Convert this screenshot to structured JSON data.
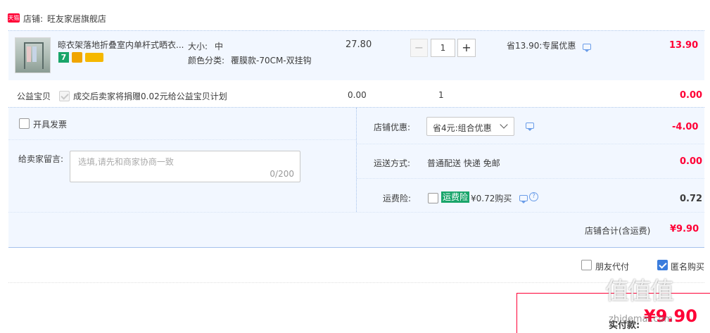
{
  "shop": {
    "badge": "天猫",
    "label": "店铺:",
    "name": "旺友家居旗舰店"
  },
  "item": {
    "title": "晾衣架落地折叠室内单杆式晒衣...",
    "size_label": "大小:",
    "size_value": "中",
    "color_label": "颜色分类:",
    "color_value": "覆膜款-70CM-双挂钩",
    "price": "27.80",
    "quantity": "1",
    "discount": "省13.90:专属优惠",
    "total": "13.90"
  },
  "charity": {
    "label": "公益宝贝",
    "text": "成交后卖家将捐赠0.02元给公益宝贝计划",
    "price": "0.00",
    "quantity": "1",
    "total": "0.00"
  },
  "invoice": {
    "label": "开具发票"
  },
  "message": {
    "label": "给卖家留言:",
    "placeholder": "选填,请先和商家协商一致",
    "counter": "0/200"
  },
  "shop_discount": {
    "label": "店铺优惠:",
    "selected": "省4元:组合优惠",
    "amount": "-4.00"
  },
  "shipping": {
    "label": "运送方式:",
    "value": "普通配送 快递 免邮",
    "amount": "0.00"
  },
  "insurance": {
    "label": "运费险:",
    "badge": "运费险",
    "value": "¥0.72购买",
    "amount": "0.72"
  },
  "shop_total": {
    "label": "店铺合计(含运费)",
    "amount": "¥9.90"
  },
  "options": {
    "friend_pay": "朋友代付",
    "anonymous": "匿名购买"
  },
  "payment": {
    "label": "实付款:",
    "amount": "¥9.90"
  },
  "watermark": {
    "top": "值值值",
    "bottom": "zhidemai.com"
  },
  "colors": {
    "accent_red": "#ff0036",
    "light_blue": "#f2f7ff",
    "checkbox_blue": "#3b7ddd",
    "dotted_border": "#a6c2ec"
  }
}
